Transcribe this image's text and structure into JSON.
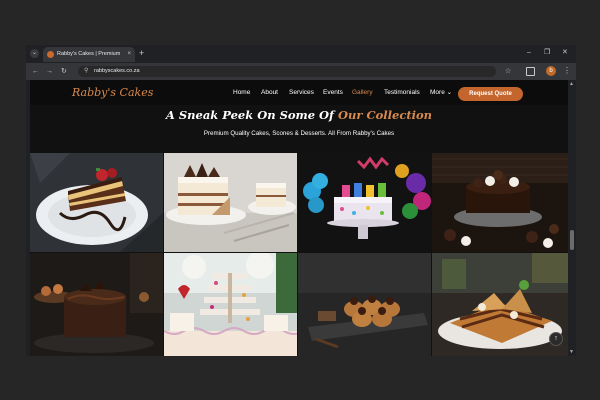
{
  "browser": {
    "tab_title": "Rabby's Cakes | Premium Qual",
    "url": "rabbyscakes.co.za",
    "new_tab": "+",
    "tab_close": "×",
    "minimize": "–",
    "restore": "❐",
    "close": "✕",
    "back": "←",
    "forward": "→",
    "reload": "↻",
    "lock": "⚲",
    "star": "☆",
    "profile": "b",
    "menu": "⋮"
  },
  "site": {
    "logo": "Rabby's Cakes",
    "nav": [
      "Home",
      "About",
      "Services",
      "Events",
      "Gallery",
      "Testimonials",
      "More ⌄"
    ],
    "active_index": 4,
    "cta": "Request Quote",
    "heading_main": "A Sneak Peek On Some Of ",
    "heading_accent": "Our Collection",
    "subheading": "Premium Quality Cakes, Scones & Desserts. All From Rabby's Cakes",
    "back_to_top": "↑"
  },
  "colors": {
    "accent": "#d98a4e",
    "button": "#c3652c",
    "page_bg": "#111111"
  },
  "gallery": [
    {
      "name": "chocolate-cake-slice-plate"
    },
    {
      "name": "vanilla-cake-slices"
    },
    {
      "name": "birthday-cake-balloons"
    },
    {
      "name": "chocolate-truffle-cake"
    },
    {
      "name": "chocolate-mousse-cake"
    },
    {
      "name": "dessert-table-tower"
    },
    {
      "name": "cupcakes-dark-board"
    },
    {
      "name": "chocolate-waffle-dessert"
    }
  ]
}
